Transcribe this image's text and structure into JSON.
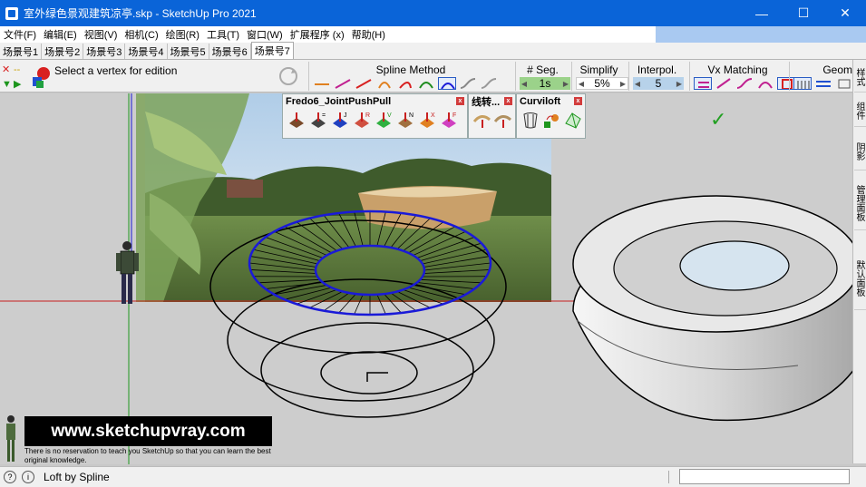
{
  "window": {
    "title": "室外绿色景观建筑凉亭.skp - SketchUp Pro 2021",
    "minimize": "—",
    "maximize": "☐",
    "close": "✕"
  },
  "menu": [
    "文件(F)",
    "编辑(E)",
    "视图(V)",
    "相机(C)",
    "绘图(R)",
    "工具(T)",
    "窗口(W)",
    "扩展程序 (x)",
    "帮助(H)"
  ],
  "scenes": [
    "场景号1",
    "场景号2",
    "场景号3",
    "场景号4",
    "场景号5",
    "场景号6",
    "场景号7"
  ],
  "active_scene_index": 6,
  "toolbar": {
    "vertex_message": "Select a vertex for edition",
    "spline_method_label": "Spline Method",
    "nseg_label": "# Seg.",
    "nseg_value": "1s",
    "simplify_label": "Simplify",
    "simplify_value": "5%",
    "interpol_label": "Interpol.",
    "interpol_value": "5",
    "vx_matching_label": "Vx Matching",
    "geom_label": "Geom"
  },
  "right_tabs": [
    "样式",
    "组件",
    "阴影",
    "管理面板",
    "默认面板"
  ],
  "panels": {
    "jpp_title": "Fredo6_JointPushPull",
    "jpp_letters": [
      "",
      "=",
      "J",
      "R",
      "V",
      "N",
      "X",
      "F"
    ],
    "linetools_title": "线转...",
    "curviloft_title": "Curviloft",
    "close_glyph": "x"
  },
  "viewport": {
    "checkmark": "✓"
  },
  "watermark": {
    "url": "www.sketchupvray.com",
    "note": "There is no reservation to teach you SketchUp so that you can learn the best original knowledge."
  },
  "status": {
    "text": "Loft by Spline",
    "info_glyph": "i"
  },
  "colors": {
    "titlebar": "#0a64d8",
    "blue_curve": "#1a1ad8",
    "red_axis": "#c81e1e",
    "green_axis": "#1e961e"
  }
}
